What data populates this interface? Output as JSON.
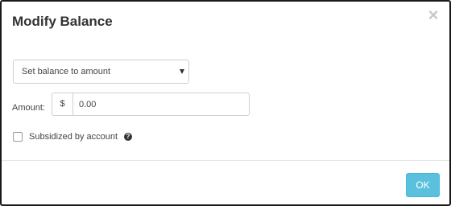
{
  "dialog": {
    "title": "Modify Balance",
    "close_symbol": "×"
  },
  "balance_mode": {
    "selected": "Set balance to amount"
  },
  "amount": {
    "label": "Amount:",
    "currency_symbol": "$",
    "value": "0.00"
  },
  "subsidized": {
    "label": "Subsidized by account",
    "checked": false,
    "help_symbol": "?"
  },
  "footer": {
    "ok_label": "OK"
  },
  "colors": {
    "ok_button": "#5bc0de",
    "title_text": "#333333",
    "close_icon": "#c8c8c8"
  }
}
